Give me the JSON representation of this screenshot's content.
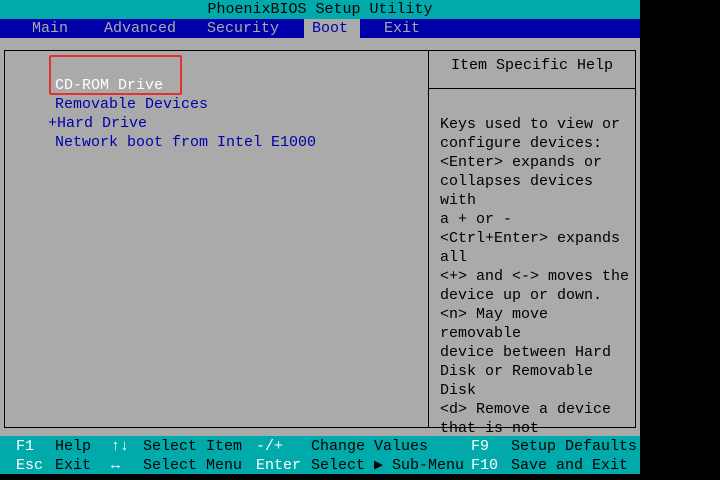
{
  "title": "PhoenixBIOS Setup Utility",
  "tabs": [
    {
      "label": "Main"
    },
    {
      "label": "Advanced"
    },
    {
      "label": "Security"
    },
    {
      "label": "Boot"
    },
    {
      "label": "Exit"
    }
  ],
  "boot_items": [
    {
      "label": "CD-ROM Drive"
    },
    {
      "label": "Removable Devices"
    },
    {
      "label": "+Hard Drive"
    },
    {
      "label": "Network boot from Intel E1000"
    }
  ],
  "help": {
    "header": "Item Specific Help",
    "lines": [
      "Keys used to view or",
      "configure devices:",
      "<Enter> expands or",
      "collapses devices with",
      "a + or -",
      "<Ctrl+Enter> expands",
      "all",
      "<+> and <-> moves the",
      "device up or down.",
      "<n> May move removable",
      "device between Hard",
      "Disk or Removable Disk",
      "<d> Remove a device",
      "that is not installed."
    ]
  },
  "footer": {
    "r1": [
      {
        "k": "F1",
        "d": "Help"
      },
      {
        "k": "↑↓",
        "d": "Select Item"
      },
      {
        "k": "-/+",
        "d": "Change Values"
      },
      {
        "k": "F9",
        "d": "Setup Defaults"
      }
    ],
    "r2": [
      {
        "k": "Esc",
        "d": "Exit"
      },
      {
        "k": "↔",
        "d": "Select Menu"
      },
      {
        "k": "Enter",
        "d": "Select ▶ Sub-Menu"
      },
      {
        "k": "F10",
        "d": "Save and Exit"
      }
    ]
  }
}
